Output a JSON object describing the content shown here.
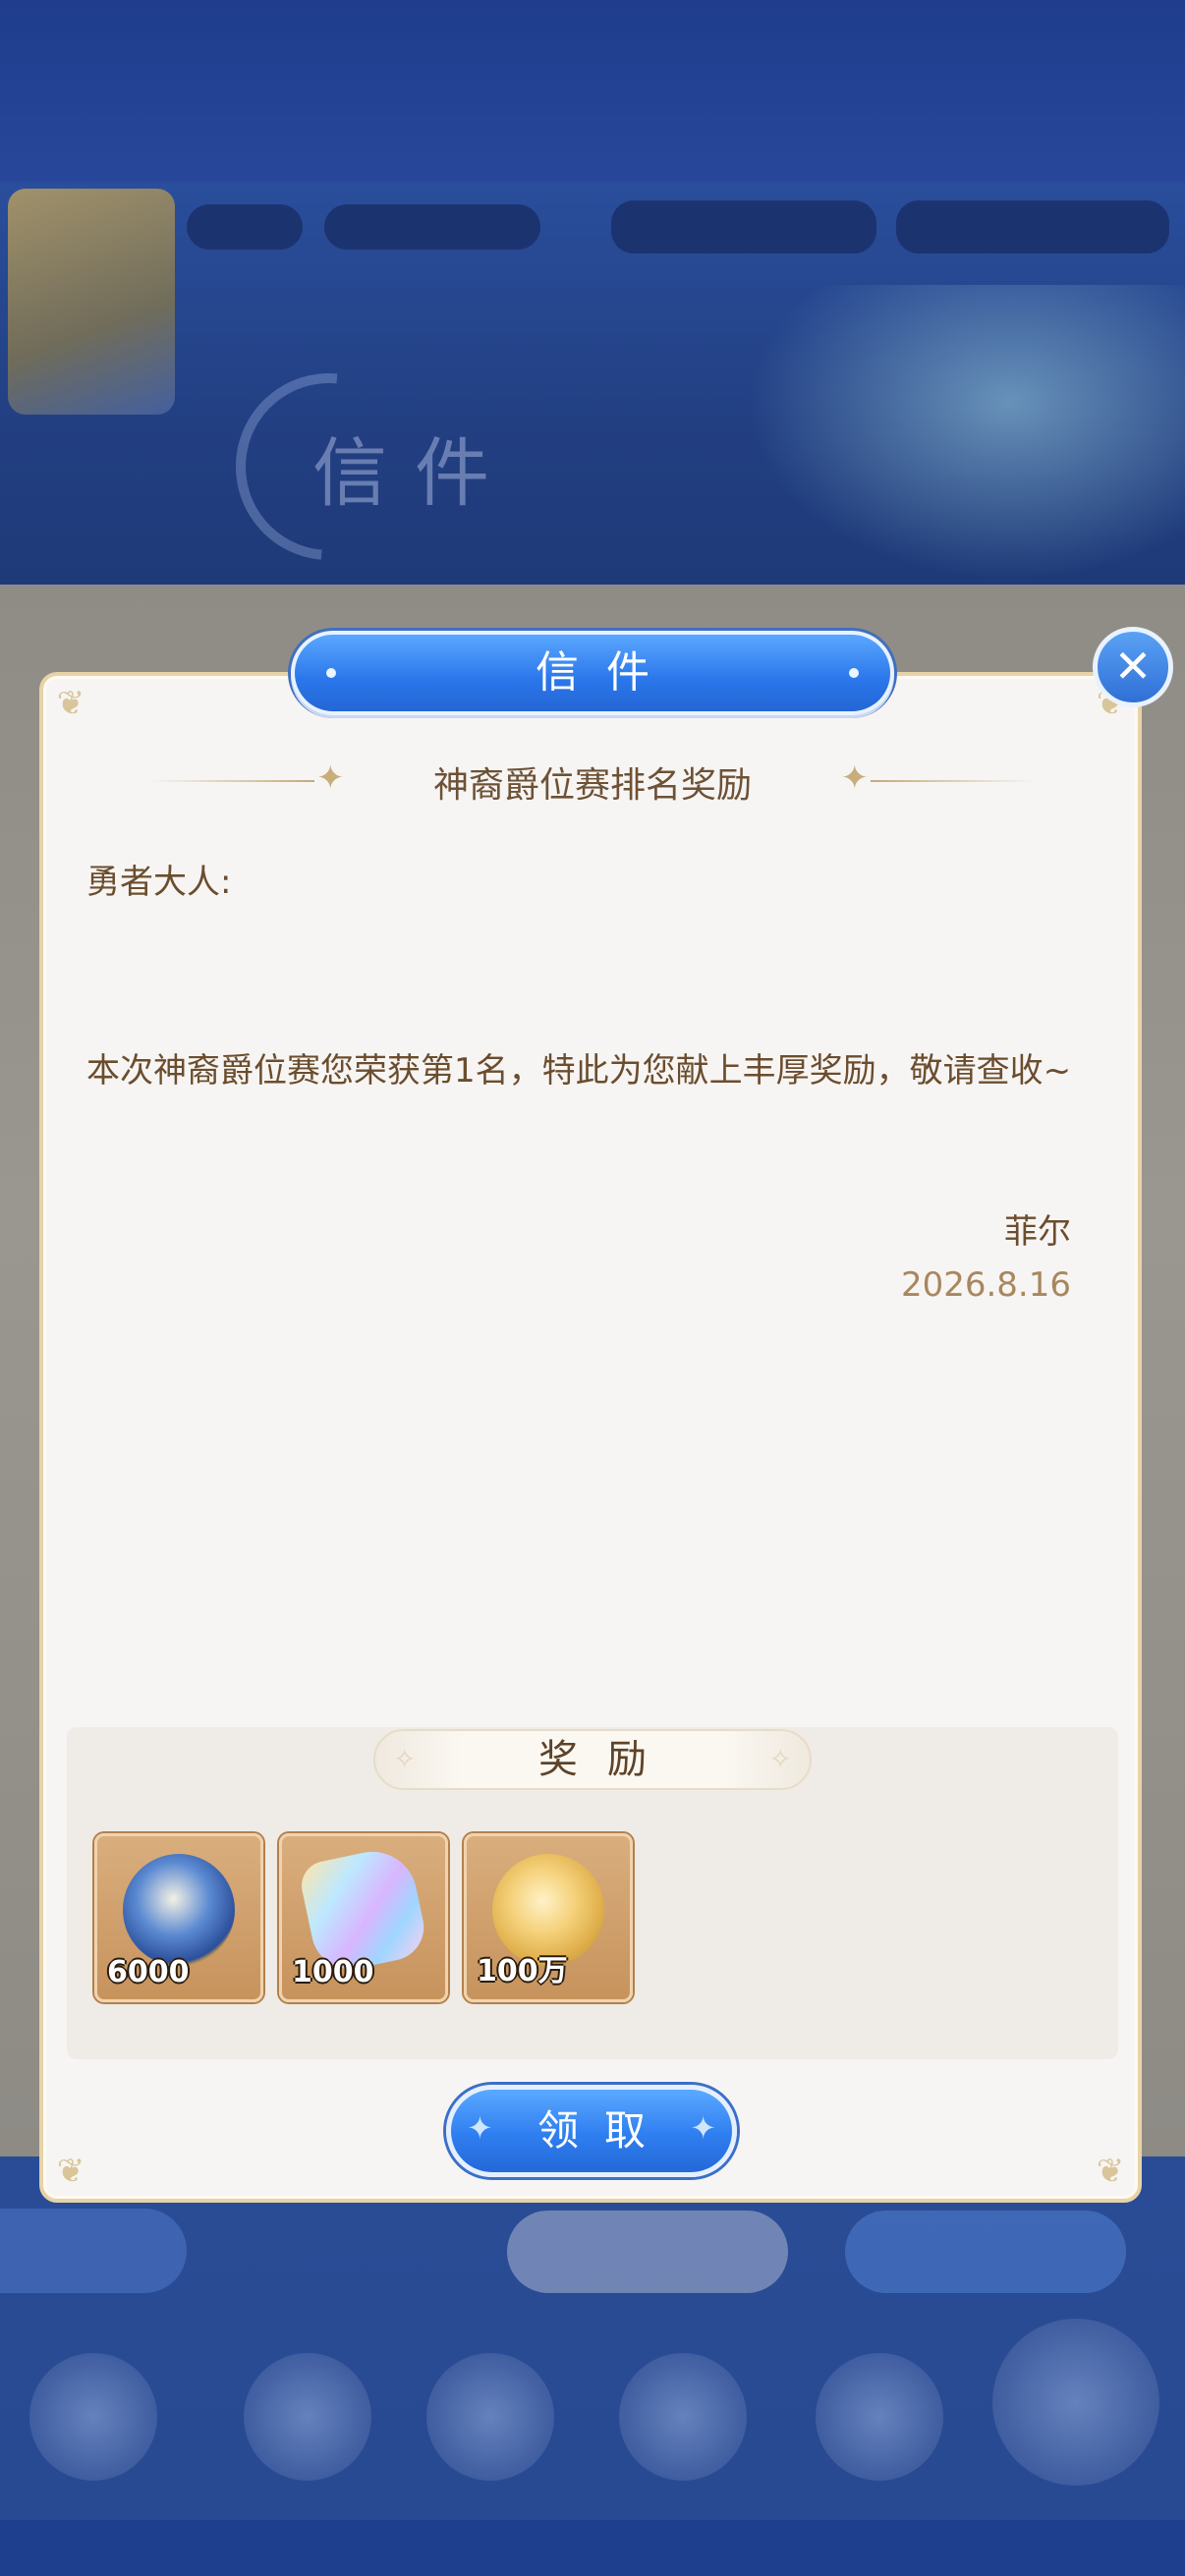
{
  "background": {
    "title": "信件"
  },
  "modal": {
    "title": "信件",
    "subject": "神裔爵位赛排名奖励",
    "greeting": "勇者大人:",
    "body": "本次神裔爵位赛您荣获第1名，特此为您献上丰厚奖励，敬请查收~",
    "sender": "菲尔",
    "date": "2026.8.16",
    "rewards_title": "奖励",
    "rewards": [
      {
        "icon": "emblem-medal-icon",
        "count": "6000"
      },
      {
        "icon": "rainbow-crystal-icon",
        "count": "1000"
      },
      {
        "icon": "gold-coin-icon",
        "count": "100万"
      }
    ],
    "claim_label": "领取",
    "close_icon": "close-icon"
  },
  "colors": {
    "accent_blue": "#2f7ef0",
    "text_brown": "#6b4d2e",
    "date_color": "#a8875e",
    "slot_bg": "#d9ae7d"
  }
}
